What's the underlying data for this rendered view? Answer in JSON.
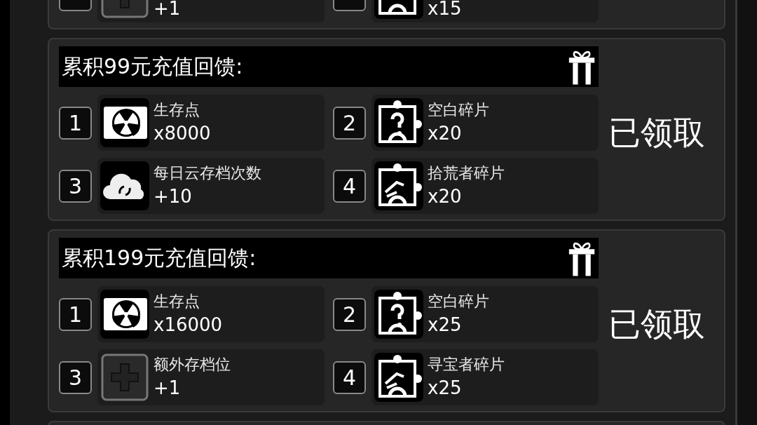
{
  "cut_card_above": {
    "items": [
      {
        "kind": "slot",
        "value": "+1"
      },
      {
        "kind": "shard",
        "value": "x15"
      }
    ]
  },
  "cards": [
    {
      "title": "累积99元充值回馈:",
      "status": "已领取",
      "items": [
        {
          "number": "1",
          "kind": "points",
          "name": "生存点",
          "value": "x8000"
        },
        {
          "number": "2",
          "kind": "blank-shard",
          "name": "空白碎片",
          "value": "x20"
        },
        {
          "number": "3",
          "kind": "cloud",
          "name": "每日云存档次数",
          "value": "+10"
        },
        {
          "number": "4",
          "kind": "shard",
          "name": "拾荒者碎片",
          "value": "x20"
        }
      ]
    },
    {
      "title": "累积199元充值回馈:",
      "status": "已领取",
      "items": [
        {
          "number": "1",
          "kind": "points",
          "name": "生存点",
          "value": "x16000"
        },
        {
          "number": "2",
          "kind": "blank-shard",
          "name": "空白碎片",
          "value": "x25"
        },
        {
          "number": "3",
          "kind": "slot",
          "name": "额外存档位",
          "value": "+1"
        },
        {
          "number": "4",
          "kind": "hunter-shard",
          "name": "寻宝者碎片",
          "value": "x25"
        }
      ]
    }
  ]
}
